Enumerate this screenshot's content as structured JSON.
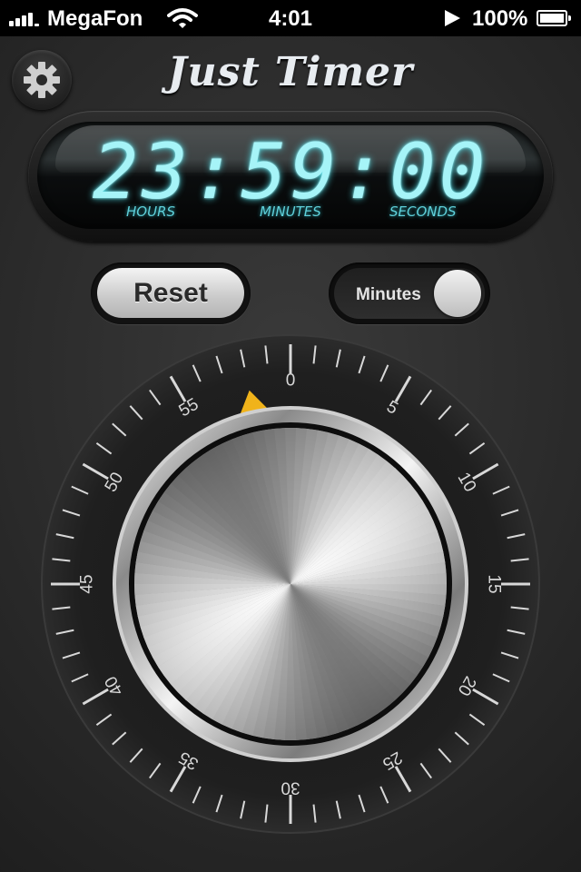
{
  "status_bar": {
    "carrier": "MegaFon",
    "time": "4:01",
    "battery": "100%"
  },
  "app": {
    "title": "Just Timer"
  },
  "display": {
    "digits": "23:59:00",
    "labels": {
      "hours": "HOURS",
      "minutes": "MINUTES",
      "seconds": "SECONDS"
    }
  },
  "controls": {
    "reset_label": "Reset",
    "mode_label": "Minutes"
  },
  "dial": {
    "labels": [
      "0",
      "5",
      "10",
      "15",
      "20",
      "25",
      "30",
      "35",
      "40",
      "45",
      "50",
      "55"
    ],
    "pointer_color": "#f0b31a",
    "pointer_minute": 58
  },
  "colors": {
    "lcd_digit": "#a6f4f8",
    "lcd_label": "#5fd0da",
    "pointer": "#f0b31a"
  }
}
